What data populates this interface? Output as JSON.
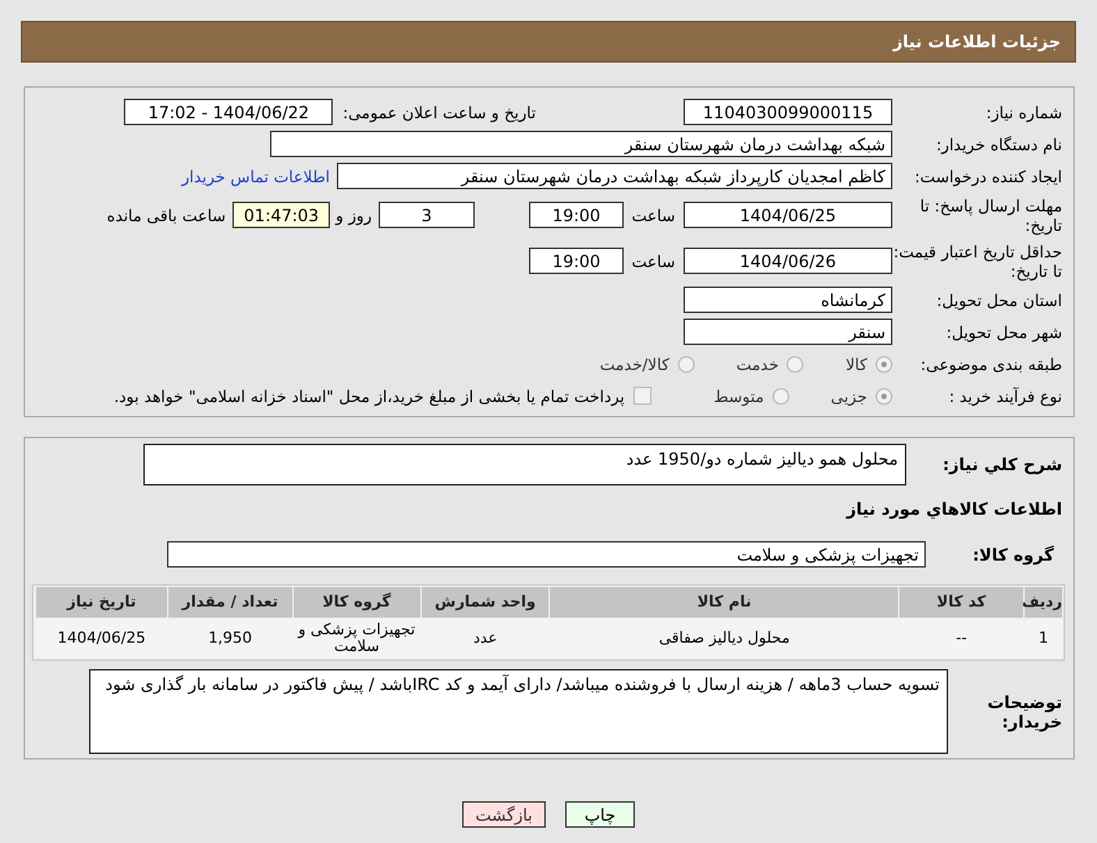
{
  "header": {
    "title": "جزئیات اطلاعات نیاز"
  },
  "need_number": {
    "label": "شماره نیاز:",
    "value": "1104030099000115"
  },
  "announce": {
    "label": "تاریخ و ساعت اعلان عمومی:",
    "value": "1404/06/22 - 17:02"
  },
  "buyer_org": {
    "label": "نام دستگاه خریدار:",
    "value": "شبکه بهداشت درمان شهرستان سنقر"
  },
  "requester": {
    "label": "ایجاد کننده درخواست:",
    "value": "کاظم امجدیان کارپرداز شبکه بهداشت درمان شهرستان سنقر",
    "link": "اطلاعات تماس خریدار"
  },
  "deadline": {
    "label": "مهلت ارسال پاسخ: تا تاریخ:",
    "date": "1404/06/25",
    "time_label": "ساعت",
    "time": "19:00",
    "days": "3",
    "days_label": "روز و",
    "remaining": "01:47:03",
    "remaining_label": "ساعت باقی مانده"
  },
  "validity": {
    "label": "حداقل تاریخ اعتبار قیمت: تا تاریخ:",
    "date": "1404/06/26",
    "time_label": "ساعت",
    "time": "19:00"
  },
  "province": {
    "label": "استان محل تحویل:",
    "value": "کرمانشاه"
  },
  "city": {
    "label": "شهر محل تحویل:",
    "value": "سنقر"
  },
  "category": {
    "label": "طبقه بندی موضوعی:",
    "options": [
      {
        "label": "کالا",
        "selected": true
      },
      {
        "label": "خدمت",
        "selected": false
      },
      {
        "label": "کالا/خدمت",
        "selected": false
      }
    ]
  },
  "process": {
    "label": "نوع فرآیند خرید :",
    "options": [
      {
        "label": "جزیی",
        "selected": true
      },
      {
        "label": "متوسط",
        "selected": false
      }
    ],
    "payment": {
      "label": "پرداخت تمام یا بخشی از مبلغ خرید،از محل \"اسناد خزانه اسلامی\" خواهد بود.",
      "checked": false
    }
  },
  "description": {
    "label": "شرح کلي نياز:",
    "value": "محلول همو دیالیز شماره دو/1950 عدد"
  },
  "goods_heading": "اطلاعات کالاهاي مورد نياز",
  "goods_group": {
    "label": "گروه کالا:",
    "value": "تجهیزات پزشکی و سلامت"
  },
  "table": {
    "columns": [
      "ردیف",
      "کد کالا",
      "نام کالا",
      "واحد شمارش",
      "گروه کالا",
      "تعداد / مقدار",
      "تاریخ نیاز"
    ],
    "rows": [
      [
        "1",
        "--",
        "محلول دیالیز صفاقی",
        "عدد",
        "تجهیزات پزشکی و سلامت",
        "1,950",
        "1404/06/25"
      ]
    ]
  },
  "buyer_notes": {
    "label": "توضیحات خریدار:",
    "value": "تسویه حساب 3ماهه / هزینه ارسال با فروشنده میباشد/ دارای آیمد و کد IRCباشد / پیش فاکتور در سامانه بار گذاری شود"
  },
  "buttons": [
    {
      "label": "چاپ",
      "kind": "print"
    },
    {
      "label": "بازگشت",
      "kind": "back"
    }
  ]
}
